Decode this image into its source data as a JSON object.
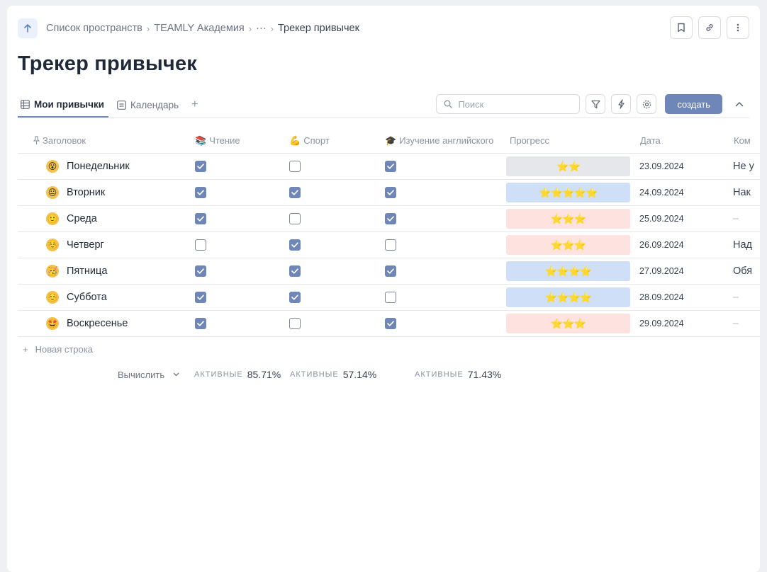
{
  "breadcrumb": {
    "items": [
      "Список пространств",
      "TEAMLY Академия",
      "···",
      "Трекер привычек"
    ]
  },
  "header": {
    "title": "Трекер привычек"
  },
  "tabs": [
    {
      "label": "Мои привычки",
      "icon": "table-icon",
      "active": true
    },
    {
      "label": "Календарь",
      "icon": "list-icon",
      "active": false
    }
  ],
  "toolbar": {
    "search_placeholder": "Поиск",
    "create_label": "создать"
  },
  "table": {
    "columns": [
      {
        "label": "Заголовок",
        "icon": "pin-icon"
      },
      {
        "label": "Чтение",
        "icon": "📚"
      },
      {
        "label": "Спорт",
        "icon": "💪"
      },
      {
        "label": "Изучение английского",
        "icon": "🎓"
      },
      {
        "label": "Прогресс",
        "icon": ""
      },
      {
        "label": "Дата",
        "icon": ""
      },
      {
        "label": "Ком",
        "icon": ""
      }
    ],
    "rows": [
      {
        "emoji": "😮",
        "name": "Понедельник",
        "reading": true,
        "sport": false,
        "english": true,
        "stars": "⭐⭐",
        "stars_count": 2,
        "progress_color": "#e5e7eb",
        "date": "23.09.2024",
        "comment": "Не у"
      },
      {
        "emoji": "😐",
        "name": "Вторник",
        "reading": true,
        "sport": true,
        "english": true,
        "stars": "⭐⭐⭐⭐⭐",
        "stars_count": 5,
        "progress_color": "#cfdff8",
        "date": "24.09.2024",
        "comment": "Нак"
      },
      {
        "emoji": "🙂",
        "name": "Среда",
        "reading": true,
        "sport": false,
        "english": true,
        "stars": "⭐⭐⭐",
        "stars_count": 3,
        "progress_color": "#fde2df",
        "date": "25.09.2024",
        "comment": "–"
      },
      {
        "emoji": "☺️",
        "name": "Четверг",
        "reading": false,
        "sport": true,
        "english": false,
        "stars": "⭐⭐⭐",
        "stars_count": 3,
        "progress_color": "#fde2df",
        "date": "26.09.2024",
        "comment": "Над"
      },
      {
        "emoji": "🥳",
        "name": "Пятница",
        "reading": true,
        "sport": true,
        "english": true,
        "stars": "⭐⭐⭐⭐",
        "stars_count": 4,
        "progress_color": "#cfdff8",
        "date": "27.09.2024",
        "comment": "Обя"
      },
      {
        "emoji": "☺️",
        "name": "Суббота",
        "reading": true,
        "sport": true,
        "english": false,
        "stars": "⭐⭐⭐⭐",
        "stars_count": 4,
        "progress_color": "#cfdff8",
        "date": "28.09.2024",
        "comment": "–"
      },
      {
        "emoji": "🤩",
        "name": "Воскресенье",
        "reading": true,
        "sport": false,
        "english": true,
        "stars": "⭐⭐⭐",
        "stars_count": 3,
        "progress_color": "#fde2df",
        "date": "29.09.2024",
        "comment": "–"
      }
    ],
    "new_row_label": "Новая строка"
  },
  "summary": {
    "calc_label": "Вычислить",
    "items": [
      {
        "label": "активные",
        "value": "85.71%"
      },
      {
        "label": "активные",
        "value": "57.14%"
      },
      {
        "label": "активные",
        "value": "71.43%"
      }
    ]
  },
  "colors": {
    "accent": "#6f87b8",
    "progress_gray": "#e5e7eb",
    "progress_blue": "#cfdff8",
    "progress_pink": "#fde2df"
  }
}
